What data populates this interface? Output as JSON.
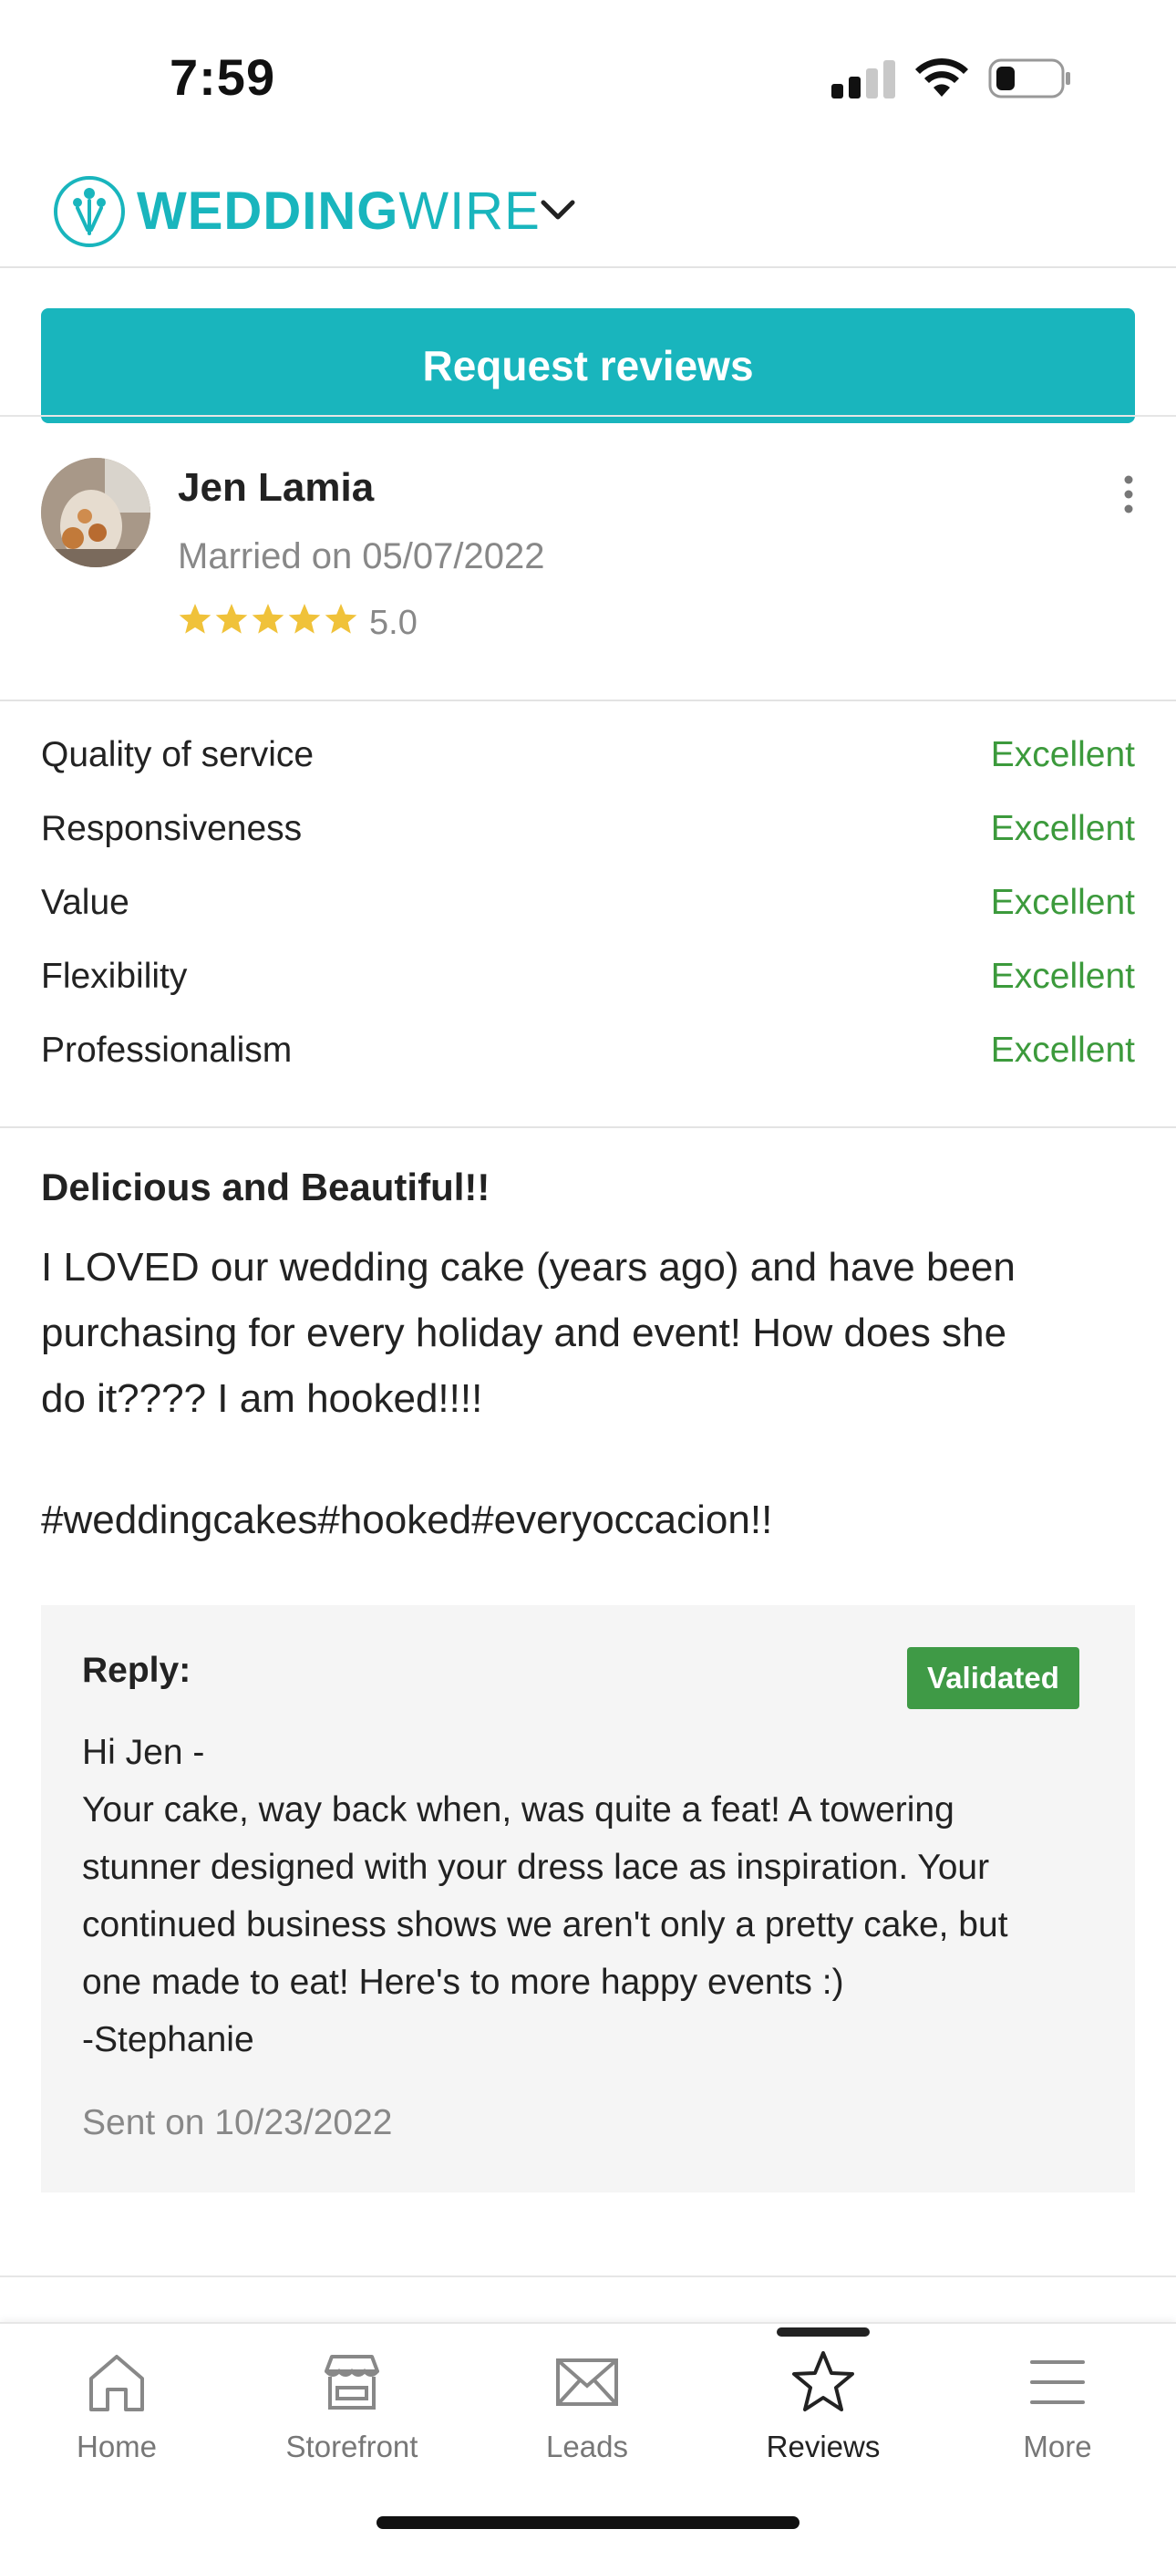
{
  "status_bar": {
    "time": "7:59"
  },
  "header": {
    "brand_bold": "WEDDING",
    "brand_light": "WIRE"
  },
  "actions": {
    "request_reviews_label": "Request reviews"
  },
  "review": {
    "reviewer_name": "Jen Lamia",
    "married_on": "Married on 05/07/2022",
    "stars": 5,
    "rating": "5.0",
    "categories": [
      {
        "label": "Quality of service",
        "value": "Excellent"
      },
      {
        "label": "Responsiveness",
        "value": "Excellent"
      },
      {
        "label": "Value",
        "value": "Excellent"
      },
      {
        "label": "Flexibility",
        "value": "Excellent"
      },
      {
        "label": "Professionalism",
        "value": "Excellent"
      }
    ],
    "title": "Delicious and Beautiful!!",
    "body_lines": [
      "I LOVED our wedding cake (years ago) and have been",
      "purchasing for every holiday and event! How does she",
      "do it???? I am hooked!!!!"
    ],
    "tags": "#weddingcakes#hooked#everyoccacion!!"
  },
  "reply": {
    "label": "Reply:",
    "badge": "Validated",
    "lines": [
      "Hi Jen -",
      "Your cake, way back when, was quite a feat! A towering",
      "stunner designed with your dress lace as inspiration. Your",
      "continued business shows we aren't only a pretty cake, but",
      "one made to eat! Here's to more happy events :)",
      "-Stephanie"
    ],
    "sent_on": "Sent on 10/23/2022"
  },
  "tabbar": {
    "items": [
      {
        "label": "Home",
        "icon": "home-icon"
      },
      {
        "label": "Storefront",
        "icon": "storefront-icon"
      },
      {
        "label": "Leads",
        "icon": "mail-icon"
      },
      {
        "label": "Reviews",
        "icon": "star-icon"
      },
      {
        "label": "More",
        "icon": "menu-icon"
      }
    ],
    "active": "Reviews"
  },
  "colors": {
    "brand_teal": "#19b5bd",
    "rating_green": "#3c9a3c",
    "validated_green": "#3f9a46",
    "star_gold": "#f0c23a"
  }
}
